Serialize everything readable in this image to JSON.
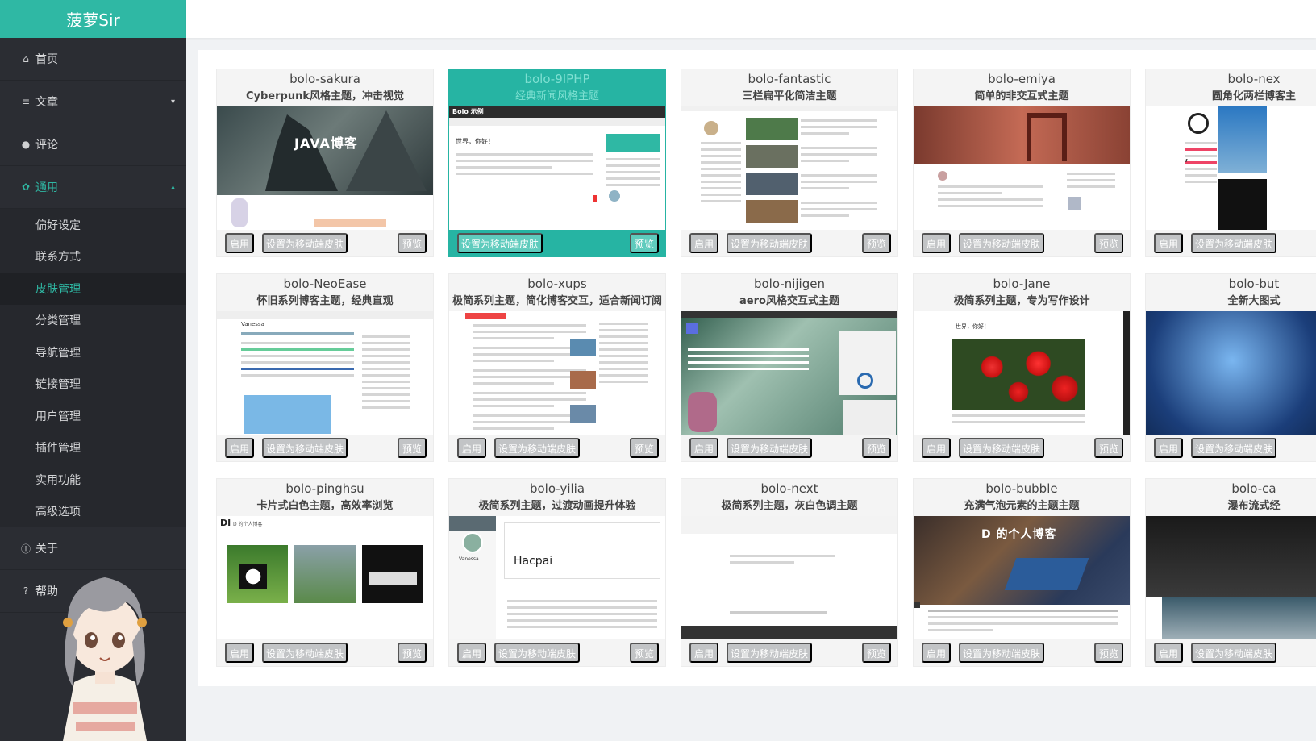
{
  "brand": "菠萝Sir",
  "nav": {
    "home": "首页",
    "articles": "文章",
    "comments": "评论",
    "general": "通用",
    "sub": [
      "偏好设定",
      "联系方式",
      "皮肤管理",
      "分类管理",
      "导航管理",
      "链接管理",
      "用户管理",
      "插件管理",
      "实用功能",
      "高级选项"
    ],
    "about": "关于",
    "help": "帮助"
  },
  "buttons": {
    "enable": "启用",
    "set_mobile": "设置为移动端皮肤",
    "preview": "预览"
  },
  "thumb_text": {
    "sakura": "JAVA博客",
    "php_header": "Bolo 示例",
    "php_greeting": "世界，你好！",
    "jane_greeting": "世界，你好！",
    "yilia_name": "Vanessa",
    "yilia_hacpai": "Hacpai",
    "bubble_title": "D 的个人博客",
    "pinghsu_logo": "DI",
    "pinghsu_site": "D 的个人博客"
  },
  "themes": [
    {
      "name": "bolo-sakura",
      "desc": "Cyberpunk风格主题，冲击视觉",
      "thumb": "sakura"
    },
    {
      "name": "bolo-9IPHP",
      "desc": "经典新闻风格主题",
      "thumb": "php",
      "active": true
    },
    {
      "name": "bolo-fantastic",
      "desc": "三栏扁平化简洁主题",
      "thumb": "fantastic"
    },
    {
      "name": "bolo-emiya",
      "desc": "简单的非交互式主题",
      "thumb": "emiya"
    },
    {
      "name": "bolo-nex",
      "desc": "圆角化两栏博客主",
      "thumb": "nex"
    },
    {
      "name": "bolo-NeoEase",
      "desc": "怀旧系列博客主题，经典直观",
      "thumb": "neoease"
    },
    {
      "name": "bolo-xups",
      "desc": "极简系列主题，简化博客交互，适合新闻订阅",
      "thumb": "xups"
    },
    {
      "name": "bolo-nijigen",
      "desc": "aero风格交互式主题",
      "thumb": "nijigen"
    },
    {
      "name": "bolo-Jane",
      "desc": "极简系列主题，专为写作设计",
      "thumb": "jane"
    },
    {
      "name": "bolo-but",
      "desc": "全新大图式",
      "thumb": "but"
    },
    {
      "name": "bolo-pinghsu",
      "desc": "卡片式白色主题，高效率浏览",
      "thumb": "pinghsu"
    },
    {
      "name": "bolo-yilia",
      "desc": "极简系列主题，过渡动画提升体验",
      "thumb": "yilia"
    },
    {
      "name": "bolo-next",
      "desc": "极简系列主题，灰白色调主题",
      "thumb": "next"
    },
    {
      "name": "bolo-bubble",
      "desc": "充满气泡元素的主题主题",
      "thumb": "bubble"
    },
    {
      "name": "bolo-ca",
      "desc": "瀑布流式经",
      "thumb": "ca"
    }
  ]
}
